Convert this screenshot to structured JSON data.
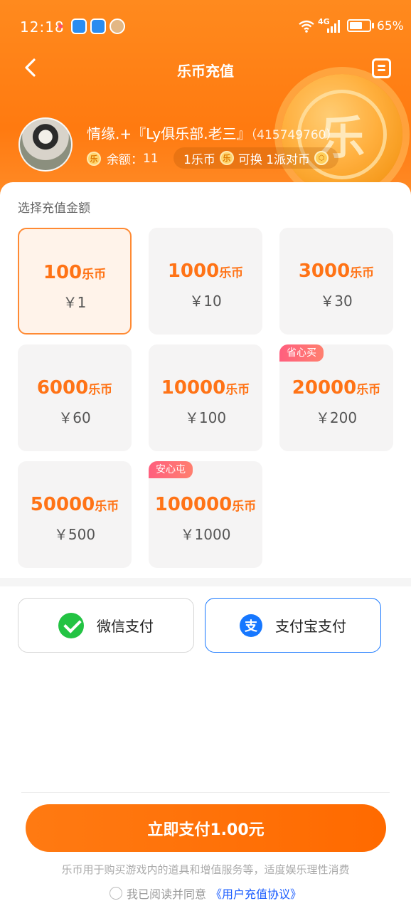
{
  "status_bar": {
    "time": "12:18",
    "network": "4G",
    "battery": "65%",
    "battery_level": 0.65
  },
  "nav": {
    "title": "乐币充值"
  },
  "profile": {
    "name": "情缘.+『Ly俱乐部.老三』",
    "uid": "（415749760）",
    "balance_label": "余额：",
    "balance_value": "11",
    "rate_left": "1乐币",
    "rate_mid": "可换 1派对币"
  },
  "coin_glyph": "乐",
  "section_title": "选择充值金额",
  "packages": [
    {
      "coins": "100",
      "unit": "乐币",
      "price": "￥1",
      "badge": ""
    },
    {
      "coins": "1000",
      "unit": "乐币",
      "price": "￥10",
      "badge": ""
    },
    {
      "coins": "3000",
      "unit": "乐币",
      "price": "￥30",
      "badge": ""
    },
    {
      "coins": "6000",
      "unit": "乐币",
      "price": "￥60",
      "badge": ""
    },
    {
      "coins": "10000",
      "unit": "乐币",
      "price": "￥100",
      "badge": ""
    },
    {
      "coins": "20000",
      "unit": "乐币",
      "price": "￥200",
      "badge": "省心买"
    },
    {
      "coins": "50000",
      "unit": "乐币",
      "price": "￥500",
      "badge": ""
    },
    {
      "coins": "100000",
      "unit": "乐币",
      "price": "￥1000",
      "badge": "安心屯"
    }
  ],
  "payment": {
    "wechat_label": "微信支付",
    "alipay_label": "支付宝支付",
    "alipay_glyph": "支"
  },
  "submit_label": "立即支付1.00元",
  "disclaimer": "乐币用于购买游戏内的道具和增值服务等，适度娱乐理性消费",
  "agreement": {
    "prefix": "我已阅读并同意",
    "link": "《用户充值协议》"
  },
  "colors": {
    "brand_orange": "#ff7a12",
    "alipay_blue": "#1677ff",
    "wechat_green": "#23c343",
    "badge_pink": "#ff5f7e"
  }
}
